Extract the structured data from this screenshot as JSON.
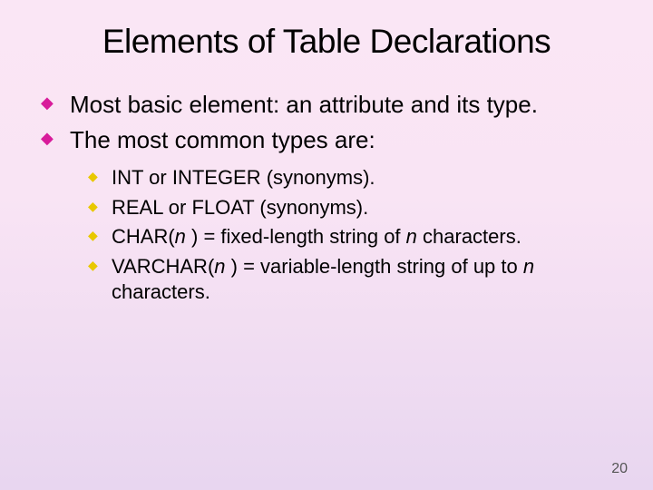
{
  "title": "Elements of Table Declarations",
  "bullets": {
    "b1": "Most basic element: an attribute and its type.",
    "b2": "The most common types are:",
    "sub1": "INT or INTEGER (synonyms).",
    "sub2": "REAL or FLOAT (synonyms).",
    "sub3a": "CHAR(",
    "sub3n": "n ",
    "sub3b": ") = fixed-length string of ",
    "sub3c": " characters.",
    "sub4a": "VARCHAR(",
    "sub4n": "n ",
    "sub4b": ") = variable-length string of up to ",
    "sub4c": "  characters."
  },
  "pageNumber": "20"
}
